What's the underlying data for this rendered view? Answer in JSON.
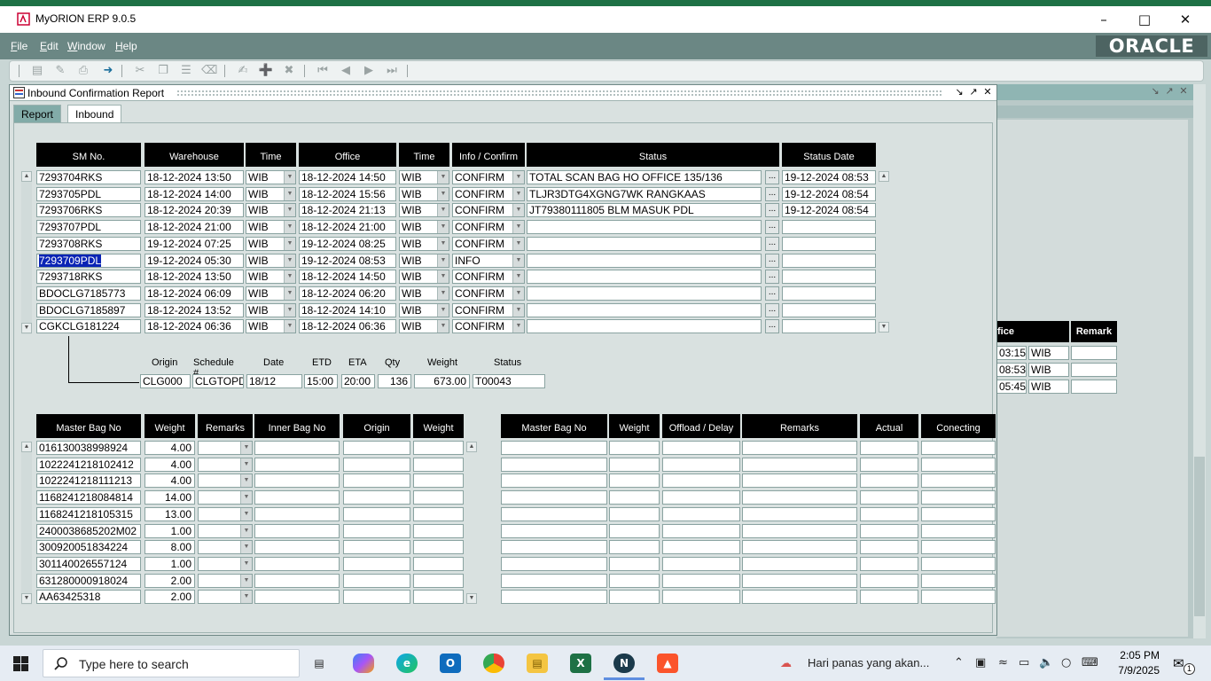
{
  "app": {
    "title": "MyORION ERP 9.0.5",
    "brand": "ORACLE"
  },
  "menu": [
    {
      "label": "File",
      "u": "F",
      "rest": "ile"
    },
    {
      "label": "Edit",
      "u": "E",
      "rest": "dit"
    },
    {
      "label": "Window",
      "u": "W",
      "rest": "indow"
    },
    {
      "label": "Help",
      "u": "H",
      "rest": "elp"
    }
  ],
  "window": {
    "title": "Inbound Confirmation Report",
    "tabs": [
      "Report",
      "Inbound"
    ],
    "selected_tab": "Inbound"
  },
  "top_table": {
    "headers": [
      "SM No.",
      "Warehouse",
      "Time",
      "Office",
      "Time",
      "Info / Confirm",
      "Status",
      "Status Date"
    ],
    "rows": [
      {
        "sm": "7293704RKS",
        "wh": "18-12-2024 13:50",
        "t1": "WIB",
        "office": "18-12-2024 14:50",
        "t2": "WIB",
        "info": "CONFIRM",
        "status": "TOTAL SCAN BAG HO OFFICE 135/136",
        "sdate": "19-12-2024 08:53"
      },
      {
        "sm": "7293705PDL",
        "wh": "18-12-2024 14:00",
        "t1": "WIB",
        "office": "18-12-2024 15:56",
        "t2": "WIB",
        "info": "CONFIRM",
        "status": "TLJR3DTG4XGNG7WK RANGKAAS",
        "sdate": "19-12-2024 08:54"
      },
      {
        "sm": "7293706RKS",
        "wh": "18-12-2024 20:39",
        "t1": "WIB",
        "office": "18-12-2024 21:13",
        "t2": "WIB",
        "info": "CONFIRM",
        "status": "JT79380111805 BLM MASUK PDL",
        "sdate": "19-12-2024 08:54"
      },
      {
        "sm": "7293707PDL",
        "wh": "18-12-2024 21:00",
        "t1": "WIB",
        "office": "18-12-2024 21:00",
        "t2": "WIB",
        "info": "CONFIRM",
        "status": "",
        "sdate": ""
      },
      {
        "sm": "7293708RKS",
        "wh": "19-12-2024 07:25",
        "t1": "WIB",
        "office": "19-12-2024 08:25",
        "t2": "WIB",
        "info": "CONFIRM",
        "status": "",
        "sdate": ""
      },
      {
        "sm": "7293709PDL",
        "wh": "19-12-2024 05:30",
        "t1": "WIB",
        "office": "19-12-2024 08:53",
        "t2": "WIB",
        "info": "INFO",
        "status": "",
        "sdate": ""
      },
      {
        "sm": "7293718RKS",
        "wh": "18-12-2024 13:50",
        "t1": "WIB",
        "office": "18-12-2024 14:50",
        "t2": "WIB",
        "info": "CONFIRM",
        "status": "",
        "sdate": ""
      },
      {
        "sm": "BDOCLG7185773",
        "wh": "18-12-2024 06:09",
        "t1": "WIB",
        "office": "18-12-2024 06:20",
        "t2": "WIB",
        "info": "CONFIRM",
        "status": "",
        "sdate": ""
      },
      {
        "sm": "BDOCLG7185897",
        "wh": "18-12-2024 13:52",
        "t1": "WIB",
        "office": "18-12-2024 14:10",
        "t2": "WIB",
        "info": "CONFIRM",
        "status": "",
        "sdate": ""
      },
      {
        "sm": "CGKCLG181224",
        "wh": "18-12-2024 06:36",
        "t1": "WIB",
        "office": "18-12-2024 06:36",
        "t2": "WIB",
        "info": "CONFIRM",
        "status": "",
        "sdate": ""
      }
    ]
  },
  "detail": {
    "labels": [
      "Origin",
      "Schedule #",
      "Date",
      "ETD",
      "ETA",
      "Qty",
      "Weight",
      "Status"
    ],
    "values": [
      "CLG000",
      "CLGTOPD",
      "18/12",
      "15:00",
      "20:00",
      "136",
      "673.00",
      "T00043"
    ]
  },
  "bag_table": {
    "headers": [
      "Master Bag No",
      "Weight",
      "Remarks",
      "Inner Bag No",
      "Origin",
      "Weight"
    ],
    "rows": [
      {
        "bag": "016130038998924",
        "w": "4.00"
      },
      {
        "bag": "1022241218102412",
        "w": "4.00"
      },
      {
        "bag": "1022241218111213",
        "w": "4.00"
      },
      {
        "bag": "1168241218084814",
        "w": "14.00"
      },
      {
        "bag": "1168241218105315",
        "w": "13.00"
      },
      {
        "bag": "2400038685202M02",
        "w": "1.00"
      },
      {
        "bag": "300920051834224",
        "w": "8.00"
      },
      {
        "bag": "301140026557124",
        "w": "1.00"
      },
      {
        "bag": "631280000918024",
        "w": "2.00"
      },
      {
        "bag": "AA63425318",
        "w": "2.00"
      }
    ]
  },
  "offload_table": {
    "headers": [
      "Master Bag No",
      "Weight",
      "Offload / Delay",
      "Remarks",
      "Actual",
      "Conecting"
    ]
  },
  "bg_window": {
    "headers": [
      "fice",
      "Remark"
    ],
    "rows": [
      [
        "03:15",
        "WIB"
      ],
      [
        "08:53",
        "WIB"
      ],
      [
        "05:45",
        "WIB"
      ]
    ]
  },
  "taskbar": {
    "search_placeholder": "Type here to search",
    "weather": "Hari panas yang akan...",
    "time": "2:05 PM",
    "date": "7/9/2025",
    "notifications": "1"
  },
  "colors": {
    "menubar": "#6b8784",
    "header": "#000000",
    "selection": "#0a24b5",
    "tab_active": "#ffffff",
    "tab_inactive": "#82aba8"
  }
}
